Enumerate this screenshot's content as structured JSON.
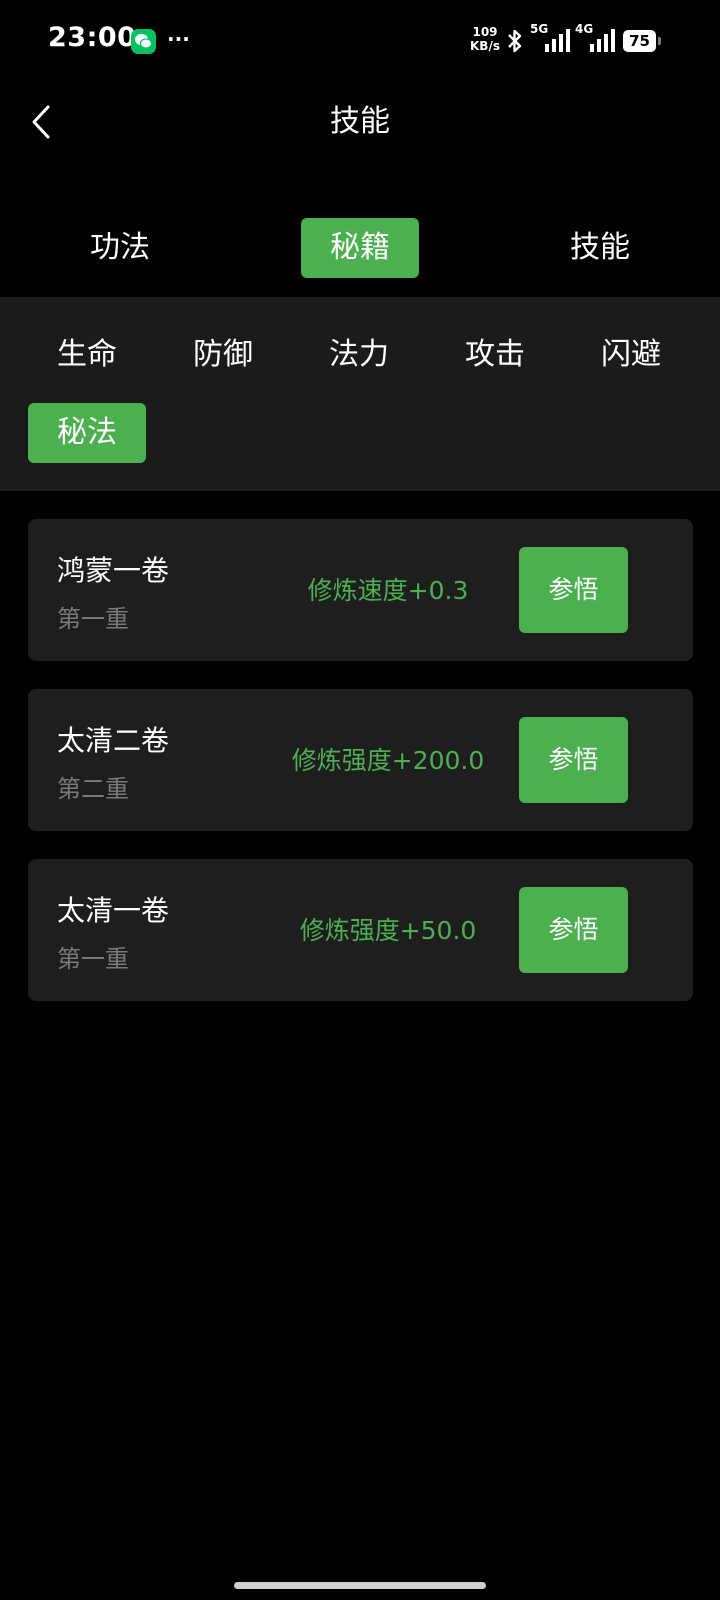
{
  "status_bar": {
    "time": "23:00",
    "net_speed_value": "109",
    "net_speed_unit": "KB/s",
    "sig1_label": "5G",
    "sig2_label": "4G",
    "battery": "75"
  },
  "header": {
    "title": "技能"
  },
  "tabs": [
    {
      "label": "功法",
      "active": false
    },
    {
      "label": "秘籍",
      "active": true
    },
    {
      "label": "技能",
      "active": false
    }
  ],
  "categories": [
    {
      "label": "生命",
      "active": false
    },
    {
      "label": "防御",
      "active": false
    },
    {
      "label": "法力",
      "active": false
    },
    {
      "label": "攻击",
      "active": false
    },
    {
      "label": "闪避",
      "active": false
    },
    {
      "label": "秘法",
      "active": true
    }
  ],
  "items": [
    {
      "name": "鸿蒙一卷",
      "level": "第一重",
      "effect": "修炼速度+0.3",
      "button": "参悟"
    },
    {
      "name": "太清二卷",
      "level": "第二重",
      "effect": "修炼强度+200.0",
      "button": "参悟"
    },
    {
      "name": "太清一卷",
      "level": "第一重",
      "effect": "修炼强度+50.0",
      "button": "参悟"
    }
  ],
  "colors": {
    "accent": "#4caf50",
    "panel": "#1b1b1b",
    "card": "#1e1e1e",
    "muted_text": "#7a7a7a"
  }
}
